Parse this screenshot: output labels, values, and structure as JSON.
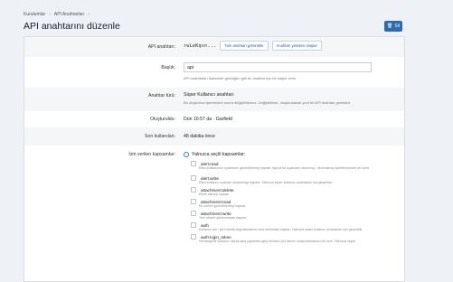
{
  "breadcrumb": [
    "Kurulumlar",
    "API Anahtarları"
  ],
  "page_title": "API anahtarını düzenle",
  "delete_button": "Sil",
  "api_key": {
    "label": "API anahtarı:",
    "masked_value": "rwLeKqsn...",
    "view_button": "Tam anahtarı görüntüle",
    "regenerate_button": "Anahtarı yeniden oluştur"
  },
  "title_field": {
    "label": "Başlık:",
    "value": "api",
    "hint": "API anahtarları listesinde gördüğün gibi bu anahtar için bir başlık verin."
  },
  "key_type": {
    "label": "Anahtar türü:",
    "value": "Süper Kullanıcı anahtarı",
    "hint": "Bu oluşturma işleminden sonra değiştirilemez. Değiştirilirse, oluşturulacak yeni bir API anahtarı gerektirir."
  },
  "created": {
    "label": "Oluşturuldu:",
    "value": "Dün 16:57 da · Garfield"
  },
  "last_used": {
    "label": "Son kullanılan:",
    "value": "48 dakika önce"
  },
  "scopes": {
    "label": "İzin verilen kapsamlar:",
    "option": "Yalnızca seçili kapsamlar:",
    "items": [
      {
        "name": "alert:read",
        "desc": "Etkin kullanıcının uyarılarını görüntülemeyi kapsar. Ayrıca bu uyarıların okunmuş / okunmamış işaretlenmesini de içerir."
      },
      {
        "name": "alert:write",
        "desc": "Etkin kullanıcı uyarıları oluşturmayı kapsar. Yalnızca süper kullanıcı anahtarları için geçerlidir."
      },
      {
        "name": "attachment:delete",
        "desc": "Ekleri silmeyi kapsar."
      },
      {
        "name": "attachment:read",
        "desc": "Ek verileri görüntülemeyi kapsar."
      },
      {
        "name": "attachment:write",
        "desc": "Yeni eklerin yüklenmesini kapsar."
      },
      {
        "name": "auth",
        "desc": "Kullanıcı adı / şifre kimlik doğrulamasının test edilmesini kapsar. Yalnızca süper kullanıcı anahtarları için geçerlidir."
      },
      {
        "name": "auth:login_token",
        "desc": "Herhangi bir kullanıcı olarak giriş yapabilen giriş belirteci (ör) tanımı oluşturulmasına izin verir. Yalnızca süper"
      }
    ]
  }
}
